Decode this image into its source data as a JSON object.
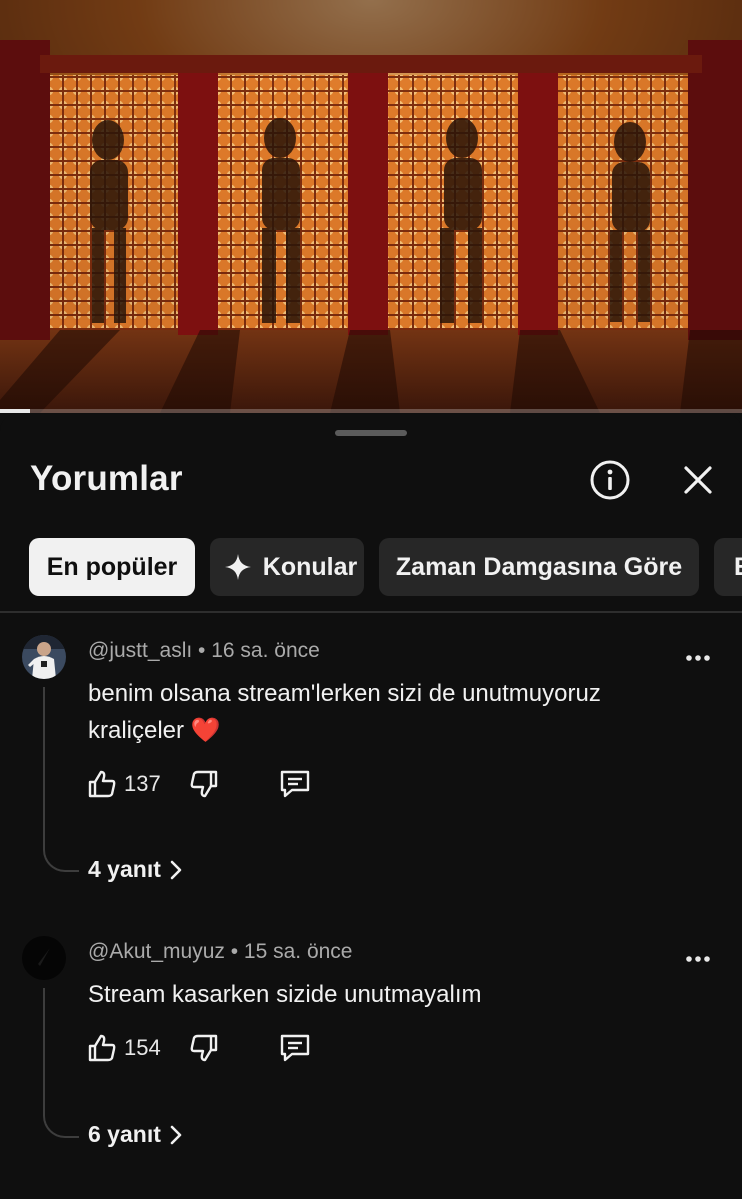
{
  "video": {
    "progress_fraction": 0.04
  },
  "sheet": {
    "title": "Yorumlar"
  },
  "chips": [
    {
      "label": "En popüler",
      "active": true
    },
    {
      "label": "Konular",
      "icon": "sparkle-icon"
    },
    {
      "label": "Zaman Damgasına Göre"
    },
    {
      "label": "E"
    }
  ],
  "comments": [
    {
      "author": "@justt_aslı",
      "time": "16 sa. önce",
      "text": "benim olsana stream'lerken sizi de unutmuyoruz kraliçeler ❤️",
      "likes": "137",
      "replies": "4 yanıt"
    },
    {
      "author": "@Akut_muyuz",
      "time": "15 sa. önce",
      "text": "Stream kasarken sizide unutmayalım",
      "likes": "154",
      "replies": "6 yanıt"
    }
  ],
  "colors": {
    "background": "#0f0f0f",
    "chip": "#272727",
    "chip_active": "#f1f1f1",
    "muted_text": "#aaaaaa"
  }
}
